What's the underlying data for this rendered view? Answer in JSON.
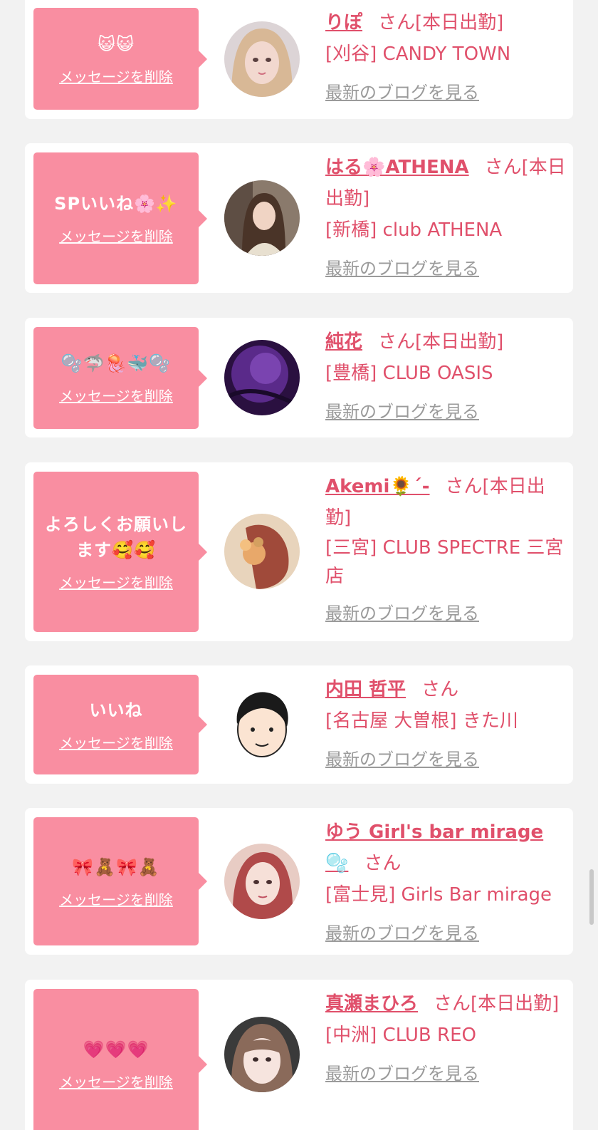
{
  "delete_label": "メッセージを削除",
  "blog_label": "最新のブログを見る",
  "san_label": "さん",
  "cards": [
    {
      "message": "😺😺",
      "name": "りぽ",
      "status": "[本日出勤]",
      "store": "[刈谷] CANDY TOWN",
      "avatar_color": "#e8c9b8"
    },
    {
      "message": "SPいいね🌸✨",
      "name": "はる🌸ATHENA",
      "status": "[本日出勤]",
      "store": "[新橋] club ATHENA",
      "avatar_color": "#6b5a4e"
    },
    {
      "message": "🫧🦈🪼🐳🫧",
      "name": "純花",
      "status": "[本日出勤]",
      "store": "[豊橋] CLUB OASIS",
      "avatar_color": "#3b1a5e"
    },
    {
      "message": "よろしくお願いします🥰🥰",
      "name": "Akemi🌻´-",
      "status": "[本日出勤]",
      "store": "[三宮] CLUB SPECTRE 三宮店",
      "avatar_color": "#a46a54"
    },
    {
      "message": "いいね",
      "name": "内田 哲平",
      "status": "",
      "store": "[名古屋 大曽根] きた川",
      "avatar_color": "#ffffff"
    },
    {
      "message": "🎀🧸🎀🧸",
      "name": "ゆう Girl's bar mirage 🫧",
      "status": "",
      "store": "[富士見] Girls Bar mirage",
      "avatar_color": "#d6a49a"
    },
    {
      "message": "💗💗💗",
      "name": "真瀬まひろ",
      "status": "[本日出勤]",
      "store": "[中洲] CLUB REO",
      "avatar_color": "#c9a899"
    }
  ]
}
